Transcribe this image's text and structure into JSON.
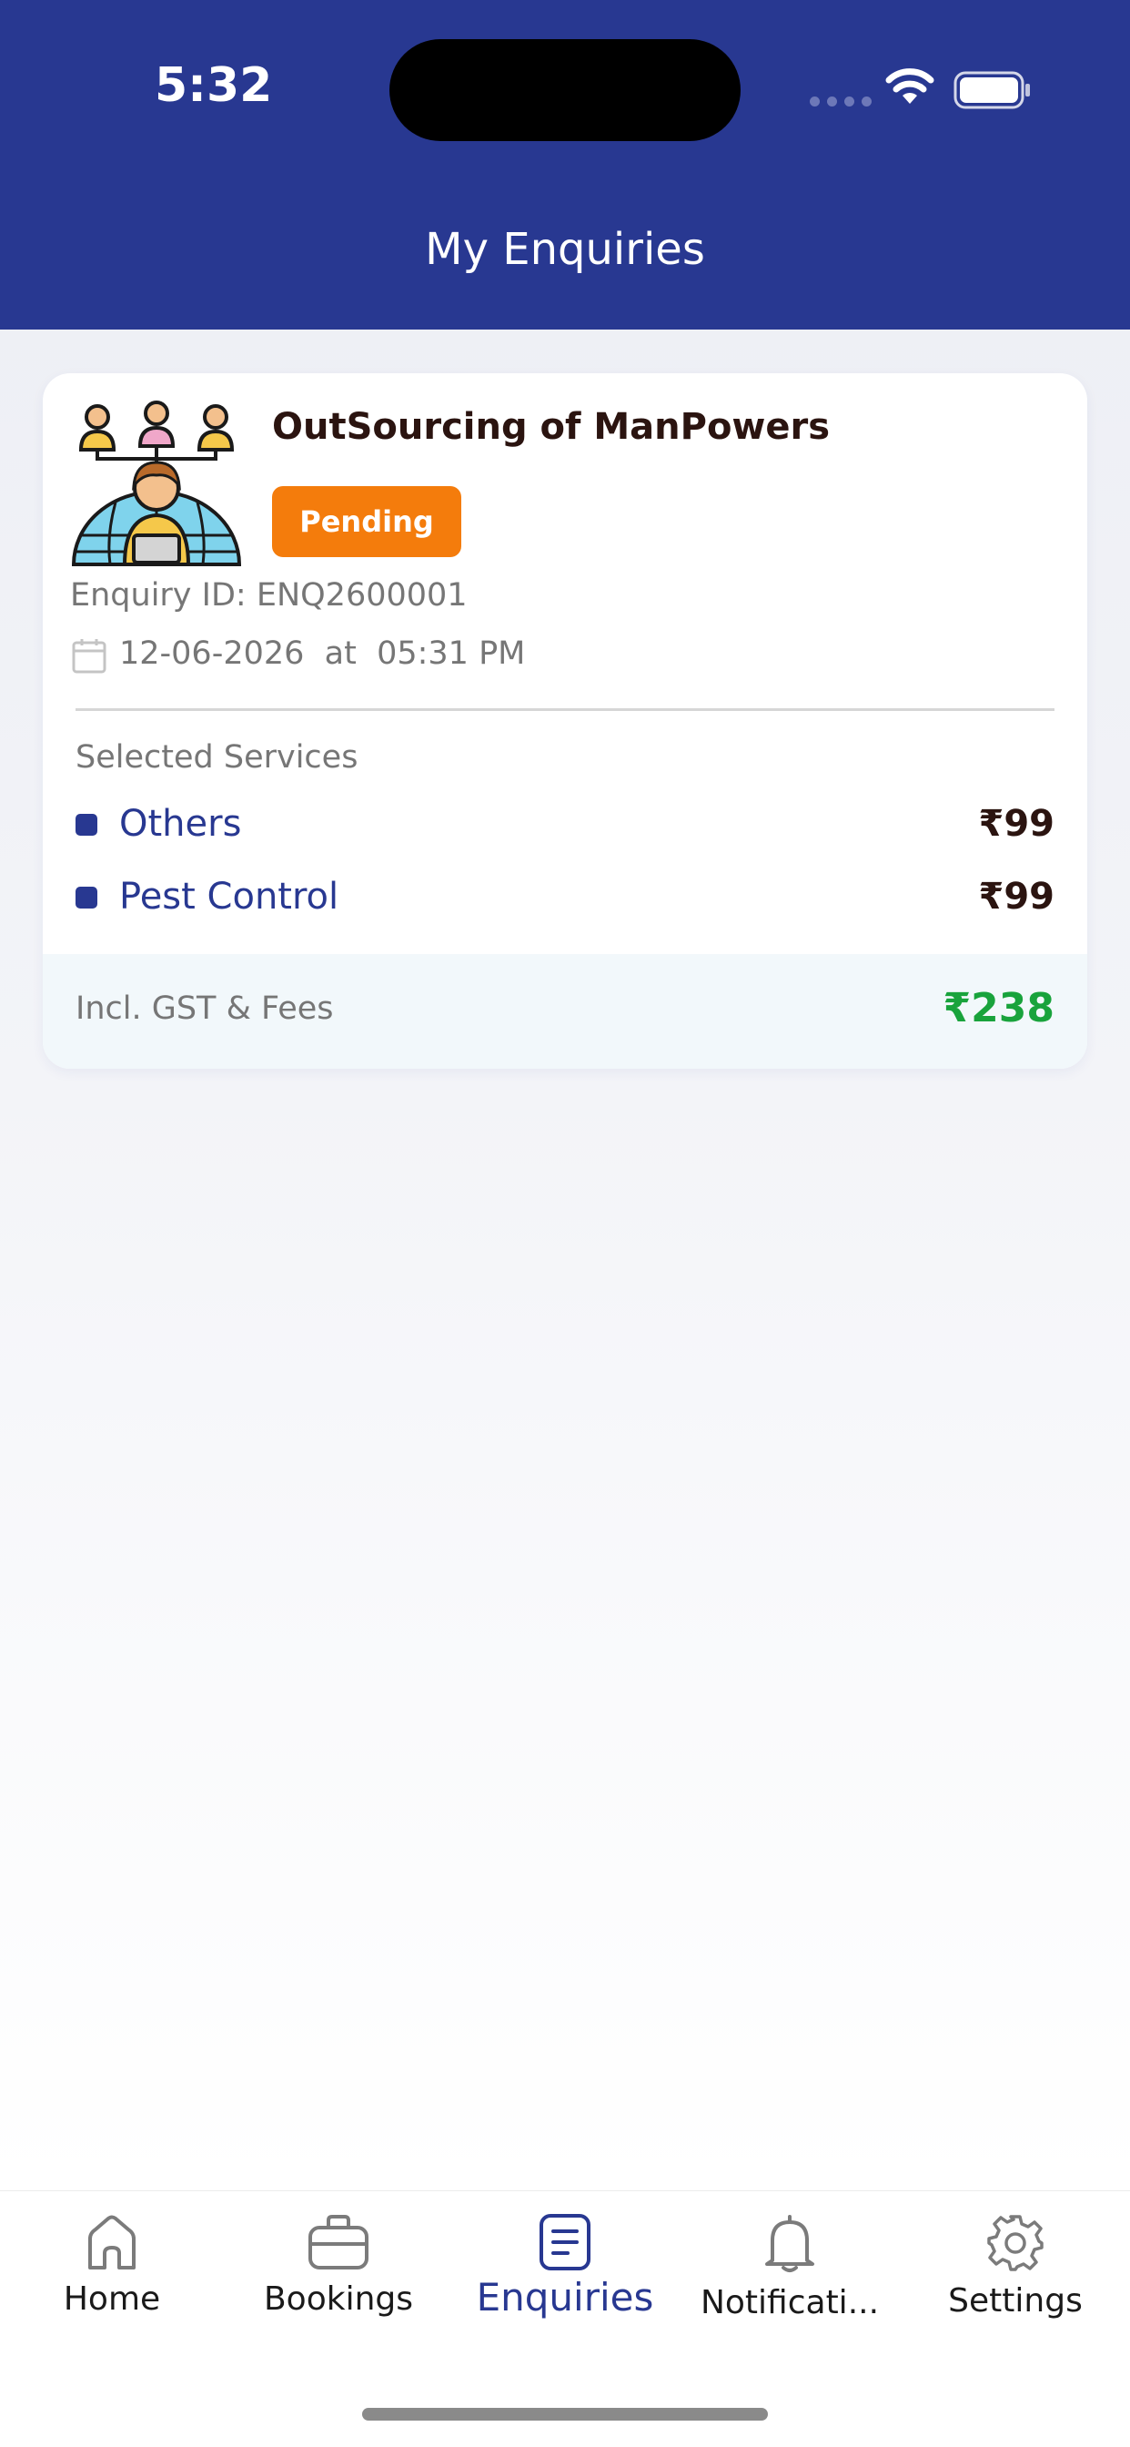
{
  "status_bar": {
    "time": "5:32"
  },
  "header": {
    "title": "My Enquiries"
  },
  "enquiry": {
    "service_name": "OutSourcing of ManPowers",
    "status": "Pending",
    "enquiry_id": "Enquiry ID: ENQ2600001",
    "datetime": "12-06-2026  at  05:31 PM",
    "selected_services_label": "Selected Services",
    "services": [
      {
        "name": "Others",
        "price": "₹99"
      },
      {
        "name": "Pest Control",
        "price": "₹99"
      }
    ],
    "fees_label": "Incl. GST & Fees",
    "total": "₹238"
  },
  "tabs": [
    {
      "label": "Home",
      "icon": "home-icon"
    },
    {
      "label": "Bookings",
      "icon": "briefcase-icon"
    },
    {
      "label": "Enquiries",
      "icon": "document-icon",
      "active": true
    },
    {
      "label": "Notificati...",
      "icon": "bell-icon"
    },
    {
      "label": "Settings",
      "icon": "gear-icon"
    }
  ],
  "colors": {
    "primary": "#283891",
    "pending": "#F47C0C",
    "total": "#19A33C"
  }
}
